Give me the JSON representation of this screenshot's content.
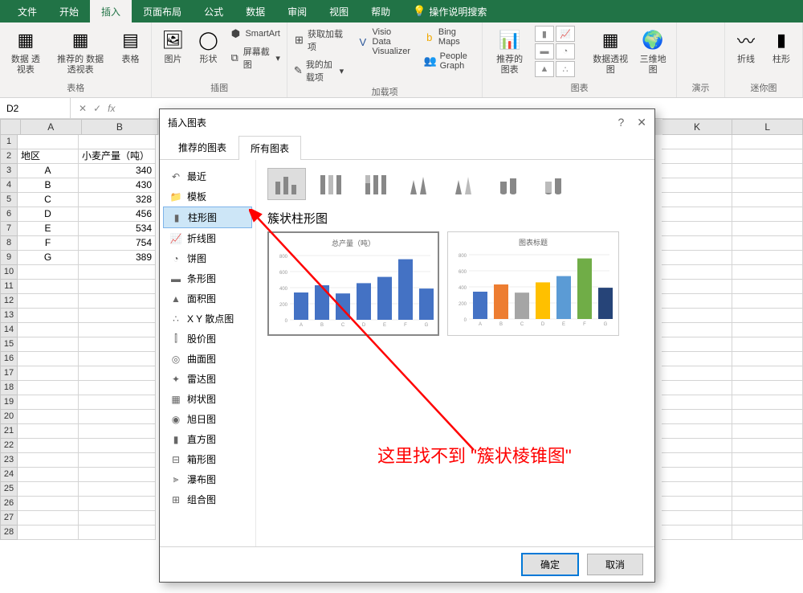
{
  "ribbon_tabs": [
    "文件",
    "开始",
    "插入",
    "页面布局",
    "公式",
    "数据",
    "审阅",
    "视图",
    "帮助"
  ],
  "active_ribbon_tab": "插入",
  "tell_me": "操作说明搜索",
  "ribbon_groups": {
    "tables": {
      "label": "表格",
      "pivot": "数据\n透视表",
      "rec_pivot": "推荐的\n数据透视表",
      "table": "表格"
    },
    "illustrations": {
      "label": "插图",
      "picture": "图片",
      "shapes": "形状",
      "smartart": "SmartArt",
      "screenshot": "屏幕截图"
    },
    "addins": {
      "label": "加载项",
      "get": "获取加载项",
      "my": "我的加载项",
      "visio": "Visio Data\nVisualizer",
      "bing": "Bing Maps",
      "people": "People Graph"
    },
    "charts": {
      "label": "图表",
      "rec": "推荐的\n图表",
      "pivot_chart": "数据透视图",
      "map3d": "三维地\n图"
    },
    "sparklines": {
      "label": "演示"
    },
    "mini": {
      "label": "迷你图",
      "line": "折线",
      "col": "柱形"
    }
  },
  "name_box": "D2",
  "spreadsheet": {
    "col_widths": {
      "A": 76,
      "B": 96,
      "K": 88,
      "L": 88
    },
    "headers": {
      "A": "地区",
      "B": "小麦产量（吨）"
    },
    "rows": [
      {
        "region": "A",
        "value": 340
      },
      {
        "region": "B",
        "value": 430
      },
      {
        "region": "C",
        "value": 328
      },
      {
        "region": "D",
        "value": 456
      },
      {
        "region": "E",
        "value": 534
      },
      {
        "region": "F",
        "value": 754
      },
      {
        "region": "G",
        "value": 389
      }
    ],
    "visible_col_letters": [
      "A",
      "B",
      "K",
      "L"
    ],
    "visible_row_count": 28
  },
  "dialog": {
    "title": "插入图表",
    "tabs": [
      "推荐的图表",
      "所有图表"
    ],
    "active_tab": "所有图表",
    "categories": [
      {
        "icon": "↶",
        "label": "最近"
      },
      {
        "icon": "📁",
        "label": "模板"
      },
      {
        "icon": "▮",
        "label": "柱形图",
        "selected": true
      },
      {
        "icon": "📈",
        "label": "折线图"
      },
      {
        "icon": "◔",
        "label": "饼图"
      },
      {
        "icon": "▬",
        "label": "条形图"
      },
      {
        "icon": "▲",
        "label": "面积图"
      },
      {
        "icon": "∴",
        "label": "X Y 散点图"
      },
      {
        "icon": "⫿",
        "label": "股价图"
      },
      {
        "icon": "◎",
        "label": "曲面图"
      },
      {
        "icon": "✦",
        "label": "雷达图"
      },
      {
        "icon": "▦",
        "label": "树状图"
      },
      {
        "icon": "◉",
        "label": "旭日图"
      },
      {
        "icon": "▮",
        "label": "直方图"
      },
      {
        "icon": "⊟",
        "label": "箱形图"
      },
      {
        "icon": "⫸",
        "label": "瀑布图"
      },
      {
        "icon": "⊞",
        "label": "组合图"
      }
    ],
    "chart_type_name": "簇状柱形图",
    "preview1_title": "总产量（吨）",
    "preview2_title": "图表标题",
    "ok": "确定",
    "cancel": "取消"
  },
  "annotation": "这里找不到 \"簇状棱锥图\"",
  "chart_data": {
    "type": "bar",
    "title": "总产量（吨）",
    "categories": [
      "A",
      "B",
      "C",
      "D",
      "E",
      "F",
      "G"
    ],
    "values": [
      340,
      430,
      328,
      456,
      534,
      754,
      389
    ],
    "ylim": [
      0,
      800
    ]
  }
}
